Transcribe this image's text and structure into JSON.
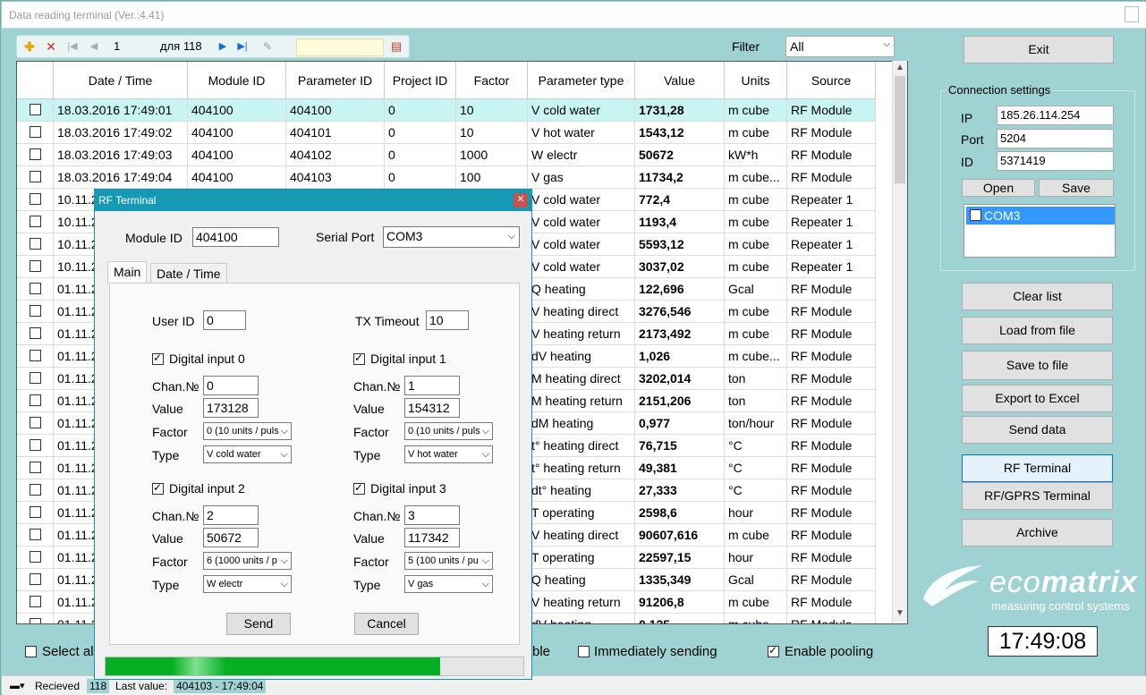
{
  "window": {
    "title": "Data reading terminal (Ver.:4.41)"
  },
  "toolbar": {
    "page": "1",
    "of_label": "для 118"
  },
  "filter": {
    "label": "Filter",
    "value": "All"
  },
  "table": {
    "headers": [
      "Date / Time",
      "Module ID",
      "Parameter ID",
      "Project ID",
      "Factor",
      "Parameter type",
      "Value",
      "Units",
      "Source"
    ],
    "rows": [
      [
        "18.03.2016 17:49:01",
        "404100",
        "404100",
        "0",
        "10",
        "V cold water",
        "1731,28",
        "m cube",
        "RF Module"
      ],
      [
        "18.03.2016 17:49:02",
        "404100",
        "404101",
        "0",
        "10",
        "V hot water",
        "1543,12",
        "m cube",
        "RF Module"
      ],
      [
        "18.03.2016 17:49:03",
        "404100",
        "404102",
        "0",
        "1000",
        "W electr",
        "50672",
        "kW*h",
        "RF Module"
      ],
      [
        "18.03.2016 17:49:04",
        "404100",
        "404103",
        "0",
        "100",
        "V gas",
        "11734,2",
        "m cube...",
        "RF Module"
      ],
      [
        "10.11.2",
        "",
        "",
        "",
        "",
        "V cold water",
        "772,4",
        "m cube",
        "Repeater 1"
      ],
      [
        "10.11.2",
        "",
        "",
        "",
        "",
        "V cold water",
        "1193,4",
        "m cube",
        "Repeater 1"
      ],
      [
        "10.11.2",
        "",
        "",
        "",
        "",
        "V cold water",
        "5593,12",
        "m cube",
        "Repeater 1"
      ],
      [
        "10.11.2",
        "",
        "",
        "",
        "",
        "V cold water",
        "3037,02",
        "m cube",
        "Repeater 1"
      ],
      [
        "01.11.2",
        "",
        "",
        "",
        "",
        "Q heating",
        "122,696",
        "Gcal",
        "RF Module"
      ],
      [
        "01.11.2",
        "",
        "",
        "",
        "",
        "V heating direct",
        "3276,546",
        "m cube",
        "RF Module"
      ],
      [
        "01.11.2",
        "",
        "",
        "",
        "",
        "V heating return",
        "2173,492",
        "m cube",
        "RF Module"
      ],
      [
        "01.11.2",
        "",
        "",
        "",
        "",
        "dV heating",
        "1,026",
        "m cube...",
        "RF Module"
      ],
      [
        "01.11.2",
        "",
        "",
        "",
        "",
        "M heating direct",
        "3202,014",
        "ton",
        "RF Module"
      ],
      [
        "01.11.2",
        "",
        "",
        "",
        "",
        "M heating return",
        "2151,206",
        "ton",
        "RF Module"
      ],
      [
        "01.11.2",
        "",
        "",
        "",
        "",
        "dM heating",
        "0,977",
        "ton/hour",
        "RF Module"
      ],
      [
        "01.11.2",
        "",
        "",
        "",
        "",
        "t° heating direct",
        "76,715",
        "°C",
        "RF Module"
      ],
      [
        "01.11.2",
        "",
        "",
        "",
        "",
        "t° heating return",
        "49,381",
        "°C",
        "RF Module"
      ],
      [
        "01.11.2",
        "",
        "",
        "",
        "",
        "dt° heating",
        "27,333",
        "°C",
        "RF Module"
      ],
      [
        "01.11.2",
        "",
        "",
        "",
        "",
        "T operating",
        "2598,6",
        "hour",
        "RF Module"
      ],
      [
        "01.11.2",
        "",
        "",
        "",
        "",
        "V heating direct",
        "90607,616",
        "m cube",
        "RF Module"
      ],
      [
        "01.11.2",
        "",
        "",
        "",
        "",
        "T operating",
        "22597,15",
        "hour",
        "RF Module"
      ],
      [
        "01.11.2",
        "",
        "",
        "",
        "",
        "Q heating",
        "1335,349",
        "Gcal",
        "RF Module"
      ],
      [
        "01.11.2",
        "",
        "",
        "",
        "",
        "V heating return",
        "91206,8",
        "m cube",
        "RF Module"
      ],
      [
        "01.11.2",
        "",
        "",
        "",
        "",
        "dV heating",
        "0,125",
        "m cube",
        "RF Module"
      ]
    ]
  },
  "right": {
    "exit": "Exit",
    "conn_title": "Connection settings",
    "ip_label": "IP",
    "ip": "185.26.114.254",
    "port_label": "Port",
    "port": "5204",
    "id_label": "ID",
    "id": "5371419",
    "open": "Open",
    "save": "Save",
    "com": "COM3",
    "clear": "Clear list",
    "load": "Load from file",
    "savefile": "Save to file",
    "excel": "Export to Excel",
    "send": "Send data",
    "rf": "RF Terminal",
    "rfgprs": "RF/GPRS Terminal",
    "archive": "Archive",
    "clock": "17:49:08"
  },
  "logo": {
    "brand1": "eco",
    "brand2": "matrix",
    "tagline": "measuring control systems"
  },
  "bottom": {
    "select_all": "Select all",
    "ble_tail": "ble",
    "immediate": "Immediately sending",
    "pooling": "Enable pooling",
    "received": "Recieved",
    "count": "118",
    "last_label": "Last value:",
    "last_value": "404103 - 17:49:04"
  },
  "dialog": {
    "title": "RF Terminal",
    "module_label": "Module ID",
    "module_id": "404100",
    "port_label": "Serial Port",
    "port": "COM3",
    "tab_main": "Main",
    "tab_dt": "Date / Time",
    "user_label": "User ID",
    "user_id": "0",
    "tx_label": "TX Timeout",
    "tx": "10",
    "chan_label": "Chan.№",
    "value_label": "Value",
    "factor_label": "Factor",
    "type_label": "Type",
    "inputs": [
      {
        "title": "Digital input 0",
        "chan": "0",
        "value": "173128",
        "factor": "0 (10 units / puls",
        "type": "V cold water"
      },
      {
        "title": "Digital input 1",
        "chan": "1",
        "value": "154312",
        "factor": "0 (10 units / puls",
        "type": "V hot water"
      },
      {
        "title": "Digital input 2",
        "chan": "2",
        "value": "50672",
        "factor": "6 (1000  units / p",
        "type": "W electr"
      },
      {
        "title": "Digital input 3",
        "chan": "3",
        "value": "117342",
        "factor": "5 (100 units / pu",
        "type": "V gas"
      }
    ],
    "send": "Send",
    "cancel": "Cancel",
    "progress": 0.8
  }
}
